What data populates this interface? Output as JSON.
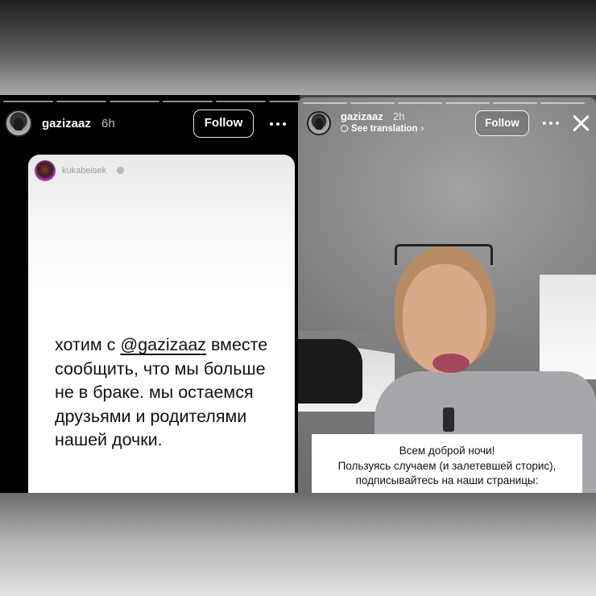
{
  "left_story": {
    "username": "gazizaaz",
    "time": "6h",
    "follow_label": "Follow",
    "more_icon": "more-horizontal-icon",
    "progress_segments": 6,
    "reposted": {
      "username": "kukabeisek",
      "verified_icon": "verified-badge-icon",
      "text_before": "хотим с ",
      "mention": "@gazizaaz",
      "text_after": " вместе сообщить, что мы больше не в браке. мы остаемся друзьями и родителями нашей дочки."
    }
  },
  "right_story": {
    "username": "gazizaaz",
    "time": "2h",
    "translation_label": "See translation",
    "follow_label": "Follow",
    "more_icon": "more-horizontal-icon",
    "close_icon": "close-icon",
    "progress_segments": 6,
    "caption_lines": [
      "Всем доброй ночи!",
      "Пользуясь случаем (и залетевшей сторис),",
      "подписывайтесь на наши страницы:"
    ]
  },
  "colors": {
    "story_background": "#000000",
    "card_background": "#ffffff",
    "text_dark": "#111111"
  }
}
